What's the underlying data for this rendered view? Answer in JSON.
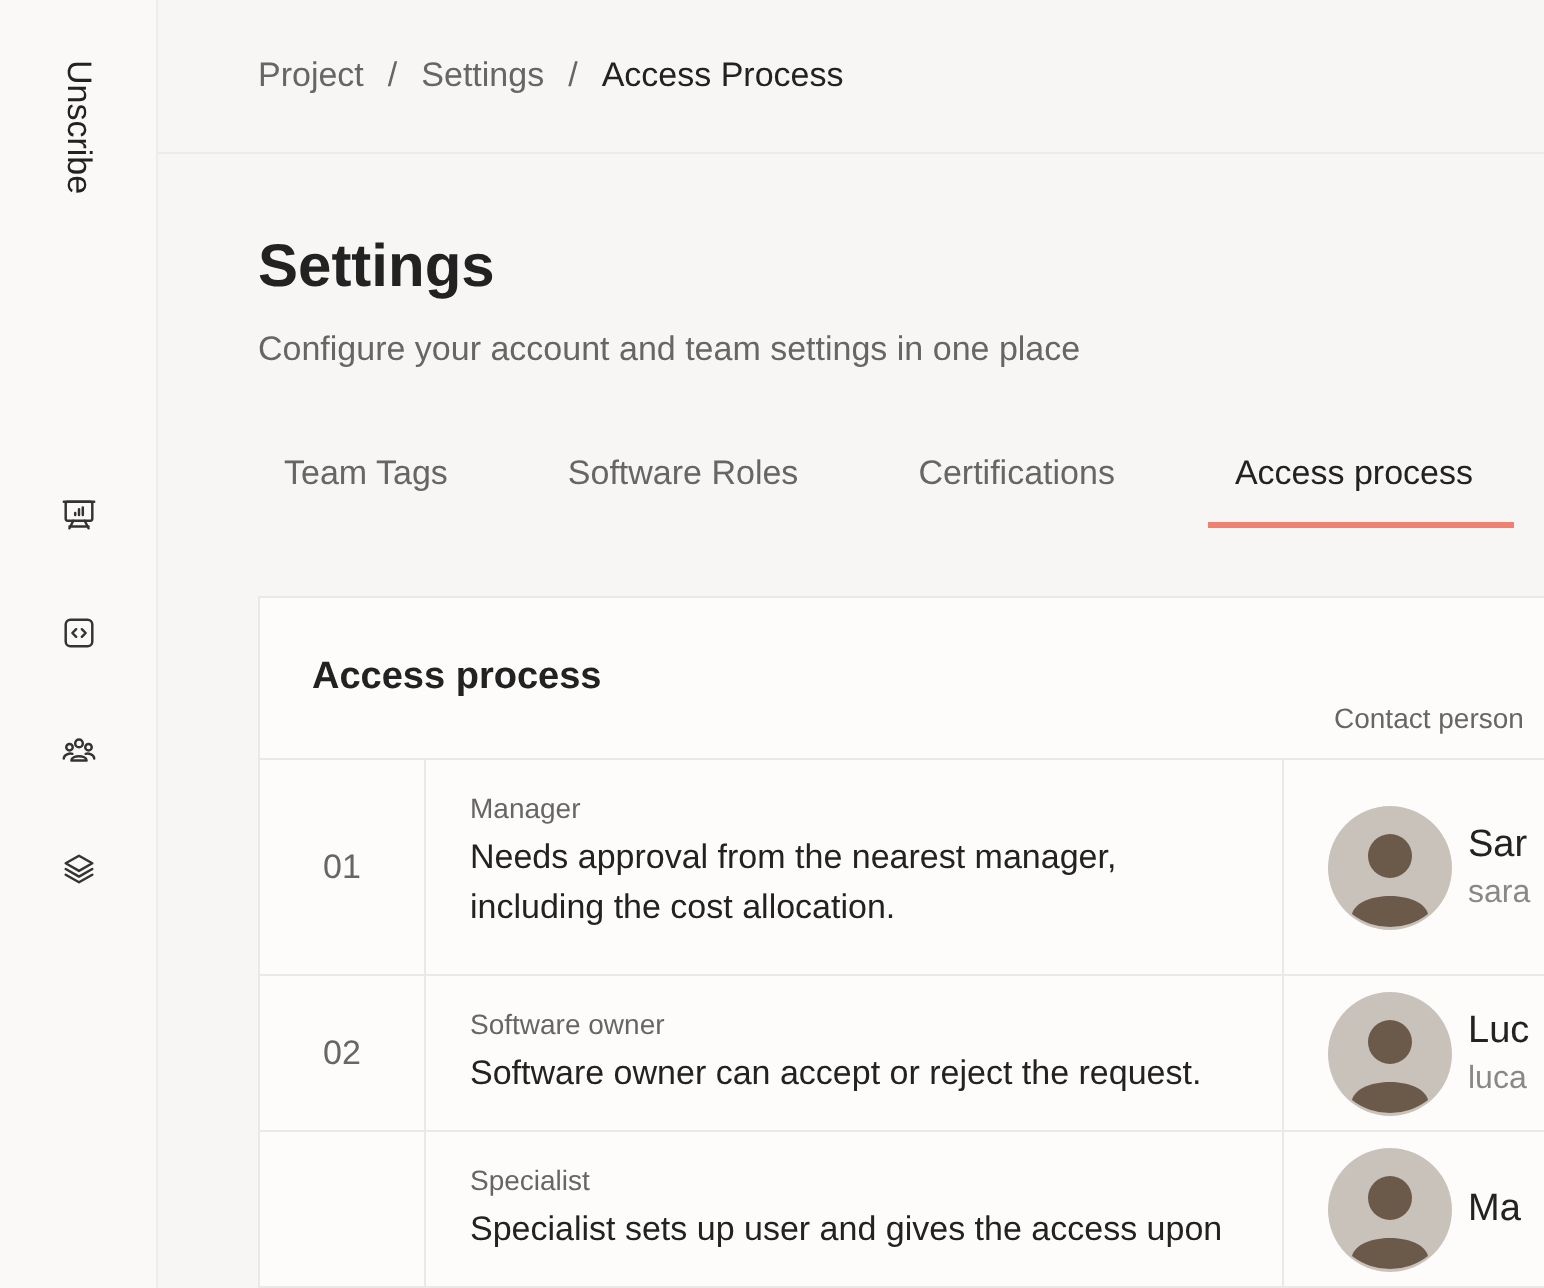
{
  "sidebar": {
    "brand": "Unscribe"
  },
  "breadcrumb": [
    {
      "label": "Project"
    },
    {
      "separator": "/",
      "label": "Settings"
    },
    {
      "separator": "/",
      "label": "Access Process"
    }
  ],
  "page": {
    "title": "Settings",
    "subtitle": "Configure your account and team settings in one place"
  },
  "tabs": [
    {
      "label": "Team Tags",
      "selected": false
    },
    {
      "label": "Software Roles",
      "selected": false
    },
    {
      "label": "Certifications",
      "selected": false
    },
    {
      "label": "Access process",
      "selected": true
    }
  ],
  "card": {
    "title": "Access process",
    "contact_header": "Contact person",
    "rows": [
      {
        "number": "01",
        "role": "Manager",
        "description": "Needs approval from the nearest manager, including the cost allocation.",
        "contact_name": "Sar",
        "contact_email": "sara"
      },
      {
        "number": "02",
        "role": "Software owner",
        "description": "Software owner can accept or reject the request.",
        "contact_name": "Luc",
        "contact_email": "luca"
      },
      {
        "role": "Specialist",
        "description": "Specialist sets up user and gives the access upon",
        "contact_name": "Ma"
      }
    ]
  }
}
